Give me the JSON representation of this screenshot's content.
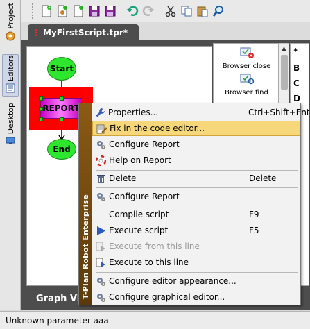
{
  "sidebar": {
    "tabs": [
      {
        "label": "Project",
        "icon": "project-icon"
      },
      {
        "label": "Editors",
        "icon": "editors-icon",
        "active": true
      },
      {
        "label": "Desktop",
        "icon": "desktop-icon"
      }
    ]
  },
  "toolbar": {
    "icons": [
      "new-script-icon",
      "new-java-icon",
      "new-file-icon",
      "save-icon",
      "save-as-icon",
      "undo-icon",
      "redo-icon",
      "cut-icon",
      "copy-icon",
      "paste-icon",
      "find-icon"
    ]
  },
  "editor": {
    "tab_title": "MyFirstScript.tpr*",
    "tab_marker": "⋮",
    "bottom_tab": "Graph Vie"
  },
  "flowchart": {
    "start_label": "Start",
    "report_label": "REPORT",
    "end_label": "End"
  },
  "palette": {
    "items": [
      {
        "label": "Browser close",
        "icon": "browser-close-icon"
      },
      {
        "label": "Browser find",
        "icon": "browser-find-icon"
      }
    ],
    "letters": [
      "*",
      "B",
      "C",
      "D"
    ]
  },
  "context_menu": {
    "brand": "T-Plan Robot Enterprise",
    "items": [
      {
        "label": "Properties...",
        "shortcut": "Ctrl+Shift+Enter",
        "icon": "wrench-icon"
      },
      {
        "label": "Fix in the code editor...",
        "shortcut": "",
        "icon": "edit-icon",
        "highlighted": true
      },
      {
        "label": "Configure Report",
        "shortcut": "",
        "icon": "gears-icon"
      },
      {
        "label": "Help on Report",
        "shortcut": "",
        "icon": "lifebuoy-icon"
      },
      {
        "label": "Delete",
        "shortcut": "Delete",
        "icon": "trash-icon"
      },
      {
        "label": "Configure Report",
        "shortcut": "",
        "icon": "gears-icon"
      },
      {
        "label": "Compile script",
        "shortcut": "F9",
        "icon": ""
      },
      {
        "label": "Execute script",
        "shortcut": "F5",
        "icon": "play-icon"
      },
      {
        "label": "Execute from this line",
        "shortcut": "",
        "icon": "execute-from-icon",
        "disabled": true
      },
      {
        "label": "Execute to this line",
        "shortcut": "",
        "icon": "execute-to-icon"
      },
      {
        "label": "Configure editor appearance...",
        "shortcut": "",
        "icon": "gears-icon"
      },
      {
        "label": "Configure graphical editor...",
        "shortcut": "",
        "icon": "gears-icon"
      }
    ]
  },
  "status": {
    "message": "Unknown parameter aaa"
  },
  "colors": {
    "highlight": "#f6d77a",
    "node_green": "#2ee62e",
    "report_red": "#ff0000",
    "brand_bar": "#8b5a14",
    "tab_dark": "#4d4d4d"
  }
}
